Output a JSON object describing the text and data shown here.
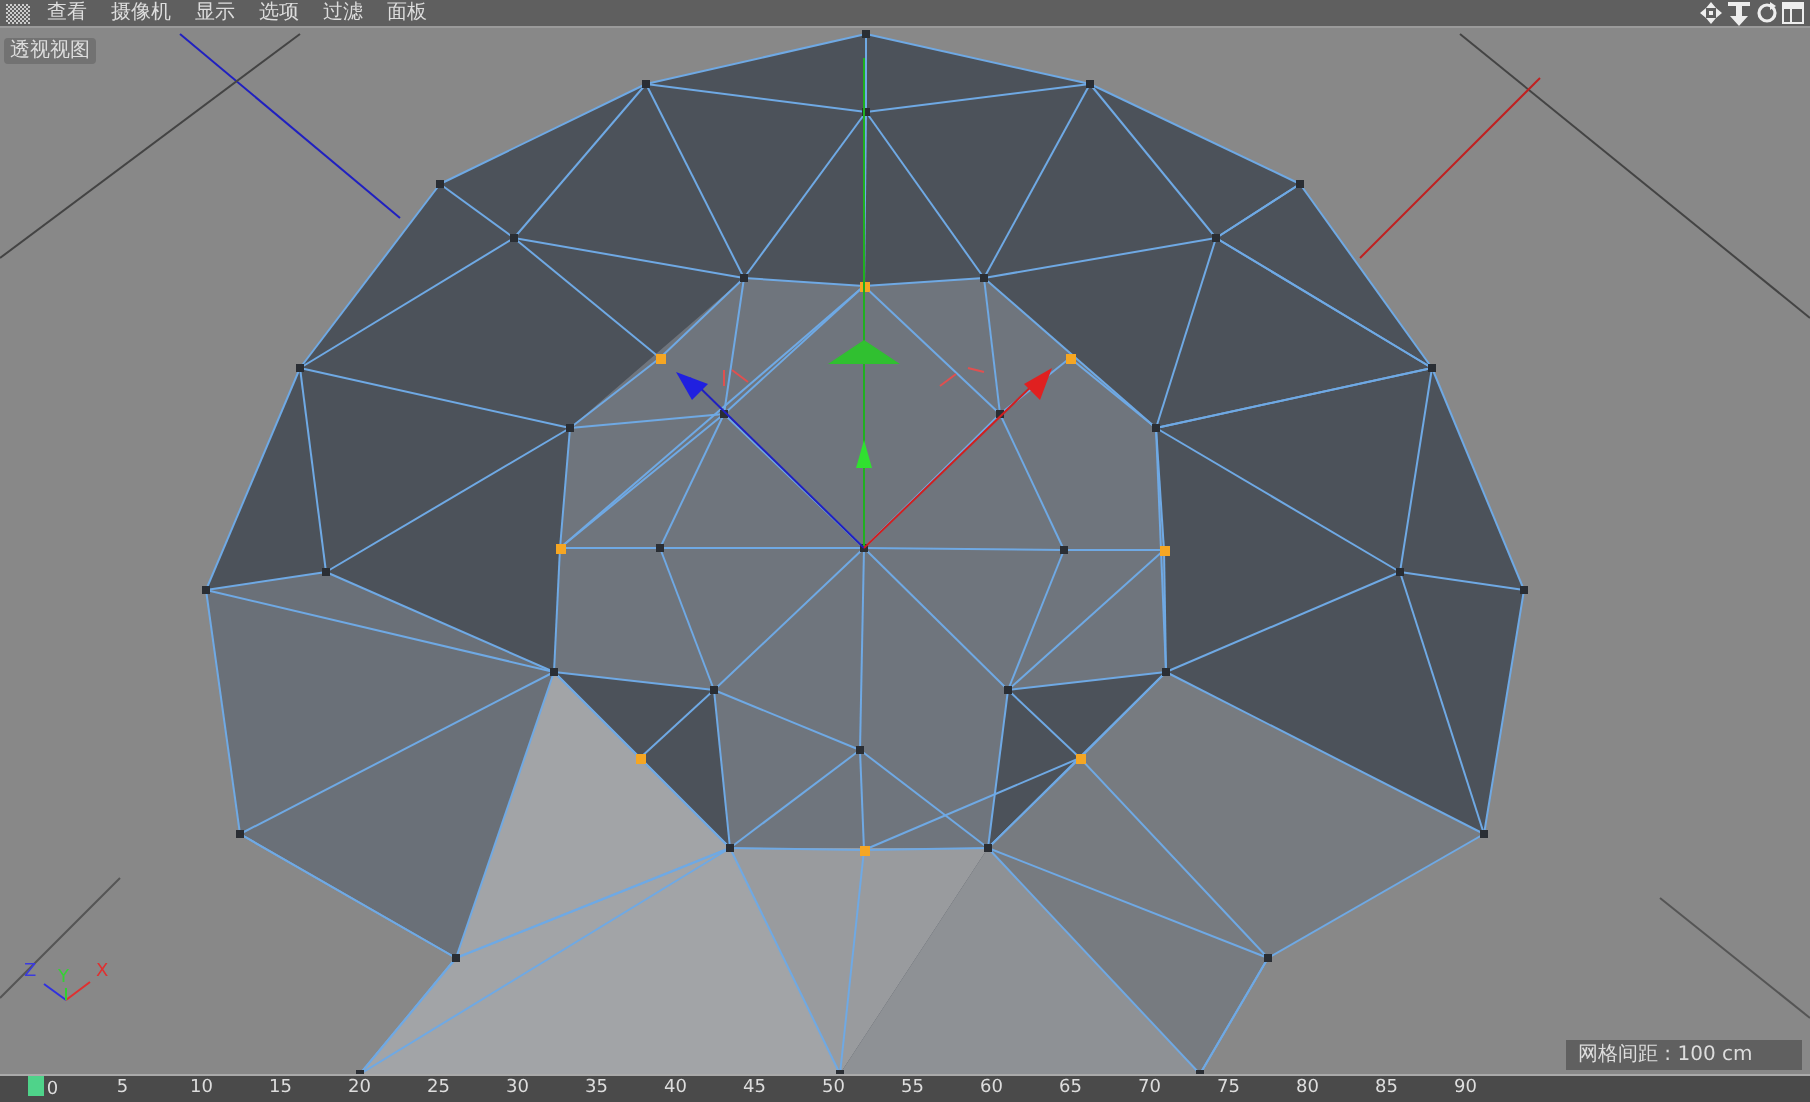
{
  "menu": [
    {
      "label": "查看"
    },
    {
      "label": "摄像机"
    },
    {
      "label": "显示"
    },
    {
      "label": "选项"
    },
    {
      "label": "过滤"
    },
    {
      "label": "面板"
    }
  ],
  "viewport": {
    "label": "透视视图",
    "grid_spacing": "网格间距 : 100 cm",
    "axes": [
      {
        "label": "Z",
        "color": "#3a3ae0"
      },
      {
        "label": "Y",
        "color": "#35d035"
      },
      {
        "label": "X",
        "color": "#e03030"
      }
    ]
  },
  "timeline": {
    "ticks": [
      {
        "label": "0",
        "selected": true
      },
      {
        "label": "5",
        "selected": false
      },
      {
        "label": "10",
        "selected": false
      },
      {
        "label": "15",
        "selected": false
      },
      {
        "label": "20",
        "selected": false
      },
      {
        "label": "25",
        "selected": false
      },
      {
        "label": "30",
        "selected": false
      },
      {
        "label": "35",
        "selected": false
      },
      {
        "label": "40",
        "selected": false
      },
      {
        "label": "45",
        "selected": false
      },
      {
        "label": "50",
        "selected": false
      },
      {
        "label": "55",
        "selected": false
      },
      {
        "label": "60",
        "selected": false
      },
      {
        "label": "65",
        "selected": false
      },
      {
        "label": "70",
        "selected": false
      },
      {
        "label": "75",
        "selected": false
      },
      {
        "label": "80",
        "selected": false
      },
      {
        "label": "85",
        "selected": false
      },
      {
        "label": "90",
        "selected": false
      }
    ]
  }
}
